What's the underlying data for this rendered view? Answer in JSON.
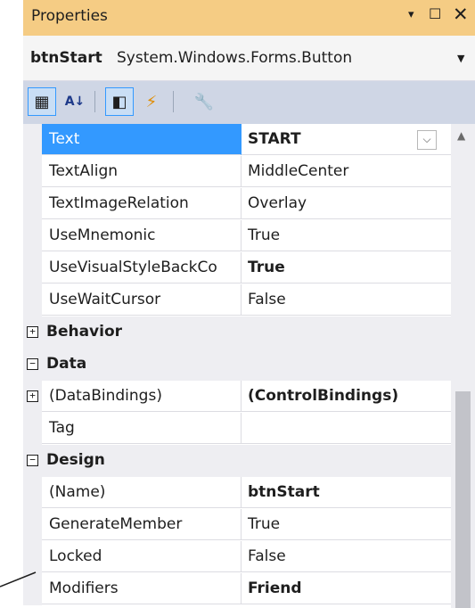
{
  "window": {
    "title": "Properties",
    "pin_glyph": "▾",
    "maximize_glyph": "☐",
    "close_glyph": "✕"
  },
  "object": {
    "name": "btnStart",
    "type": "System.Windows.Forms.Button",
    "dropdown_glyph": "▼"
  },
  "toolbar": {
    "categorized_icon": "▦",
    "alphabetical_icon": "A↓",
    "properties_icon": "◧",
    "events_icon": "⚡",
    "property_pages_icon": "🔧"
  },
  "grid": {
    "rows": [
      {
        "name": "Text",
        "value": "START"
      },
      {
        "name": "TextAlign",
        "value": "MiddleCenter"
      },
      {
        "name": "TextImageRelation",
        "value": "Overlay"
      },
      {
        "name": "UseMnemonic",
        "value": "True"
      },
      {
        "name": "UseVisualStyleBackCo",
        "value": "True"
      },
      {
        "name": "UseWaitCursor",
        "value": "False"
      },
      {
        "category": "Behavior",
        "expanded": false
      },
      {
        "category": "Data",
        "expanded": true
      },
      {
        "name": "(DataBindings)",
        "value": "(ControlBindings)"
      },
      {
        "name": "Tag",
        "value": ""
      },
      {
        "category": "Design",
        "expanded": true
      },
      {
        "name": "(Name)",
        "value": "btnStart"
      },
      {
        "name": "GenerateMember",
        "value": "True"
      },
      {
        "name": "Locked",
        "value": "False"
      },
      {
        "name": "Modifiers",
        "value": "Friend"
      }
    ],
    "dropdown_glyph": "⌵",
    "plus_glyph": "+",
    "minus_glyph": "−"
  },
  "scrollbar": {
    "up_glyph": "▲"
  },
  "colors": {
    "title_bar": "#f5cc84",
    "selection": "#3399ff",
    "toolbar": "#cfd6e5"
  }
}
